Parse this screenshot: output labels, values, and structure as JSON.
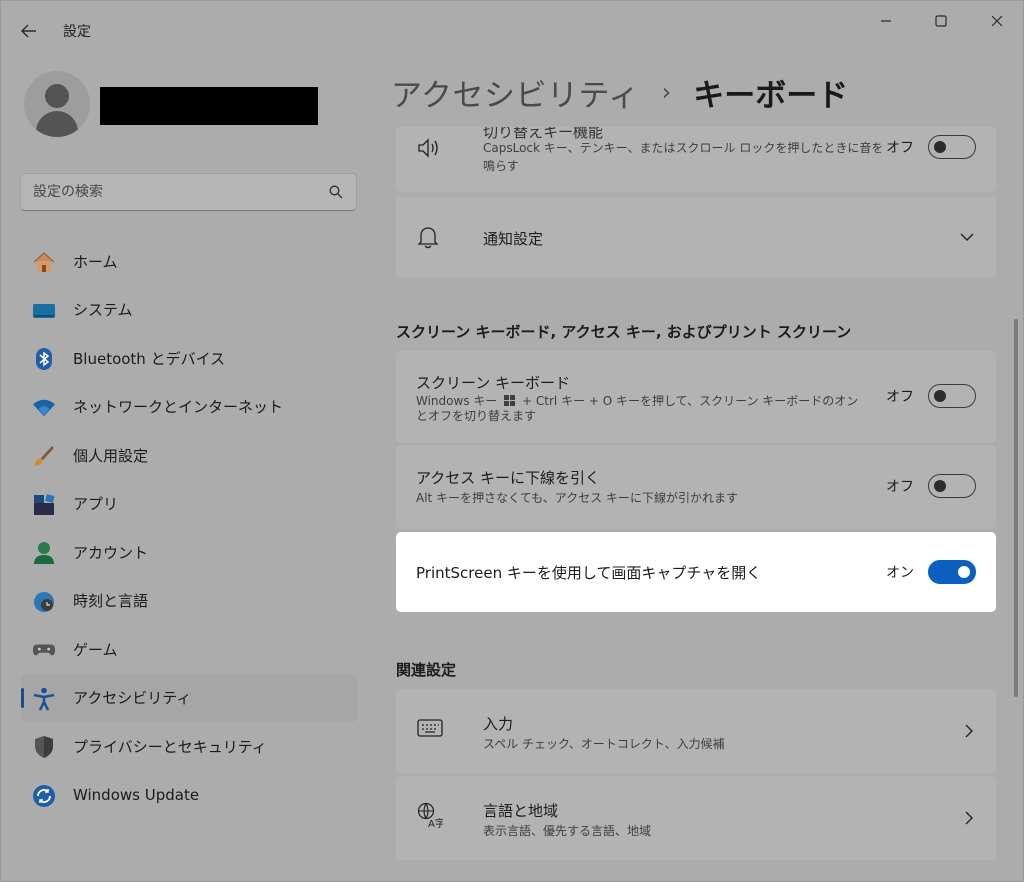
{
  "window": {
    "title": "設定",
    "controls": {
      "minimize": "minimize-icon",
      "maximize": "maximize-icon",
      "close": "close-icon"
    }
  },
  "search": {
    "placeholder": "設定の検索"
  },
  "nav": {
    "items": [
      {
        "label": "ホーム",
        "icon": "home-icon"
      },
      {
        "label": "システム",
        "icon": "system-icon"
      },
      {
        "label": "Bluetooth とデバイス",
        "icon": "bluetooth-icon"
      },
      {
        "label": "ネットワークとインターネット",
        "icon": "wifi-icon"
      },
      {
        "label": "個人用設定",
        "icon": "brush-icon"
      },
      {
        "label": "アプリ",
        "icon": "apps-icon"
      },
      {
        "label": "アカウント",
        "icon": "account-icon"
      },
      {
        "label": "時刻と言語",
        "icon": "globe-clock-icon"
      },
      {
        "label": "ゲーム",
        "icon": "gamepad-icon"
      },
      {
        "label": "アクセシビリティ",
        "icon": "accessibility-icon",
        "active": true
      },
      {
        "label": "プライバシーとセキュリティ",
        "icon": "shield-icon"
      },
      {
        "label": "Windows Update",
        "icon": "update-icon"
      }
    ]
  },
  "header": {
    "parent": "アクセシビリティ",
    "separator": "›",
    "current": "キーボード"
  },
  "cards": {
    "toggle_keys": {
      "title_partial": "切り替えキー機能",
      "desc": "CapsLock キー、テンキー、またはスクロール ロックを押したときに音を鳴らす",
      "state": "オフ",
      "on": false
    },
    "notifications": {
      "title": "通知設定"
    },
    "screen_section": {
      "title": "スクリーン キーボード, アクセス キー, およびプリント スクリーン"
    },
    "onscreen_keyboard": {
      "title": "スクリーン キーボード",
      "desc_part1": "Windows キー",
      "desc_part2": "+ Ctrl キー + O キーを押して、スクリーン キーボードのオンとオフを切り替えます",
      "state": "オフ",
      "on": false
    },
    "access_keys": {
      "title": "アクセス キーに下線を引く",
      "desc": "Alt キーを押さなくても、アクセス キーに下線が引かれます",
      "state": "オフ",
      "on": false
    },
    "printscreen": {
      "title": "PrintScreen キーを使用して画面キャプチャを開く",
      "state": "オン",
      "on": true
    },
    "related_section": {
      "title": "関連設定"
    },
    "typing": {
      "title": "入力",
      "desc": "スペル チェック、オートコレクト、入力候補"
    },
    "language": {
      "title": "言語と地域",
      "desc": "表示言語、優先する言語、地域"
    }
  },
  "colors": {
    "accent": "#0d5fbf",
    "overlay_bg": "#acacac",
    "highlight": "#ffffff"
  }
}
